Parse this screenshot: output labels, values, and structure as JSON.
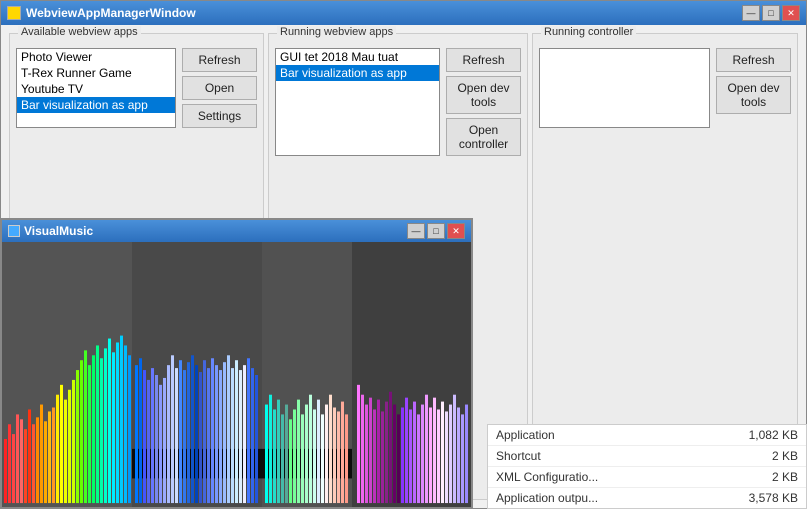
{
  "mainWindow": {
    "title": "WebviewAppManagerWindow",
    "titleButtons": {
      "minimize": "—",
      "maximize": "□",
      "close": "✕"
    }
  },
  "availableApps": {
    "label": "Available webview apps",
    "items": [
      {
        "text": "Photo Viewer",
        "selected": false
      },
      {
        "text": "T-Rex Runner Game",
        "selected": false
      },
      {
        "text": "Youtube TV",
        "selected": false
      },
      {
        "text": "Bar visualization as app",
        "selected": true
      }
    ],
    "buttons": {
      "refresh": "Refresh",
      "open": "Open",
      "settings": "Settings"
    }
  },
  "runningApps": {
    "label": "Running webview apps",
    "items": [
      {
        "text": "GUI tet 2018 Mau tuat",
        "selected": false
      },
      {
        "text": "Bar visualization as app",
        "selected": true
      }
    ],
    "buttons": {
      "refresh": "Refresh",
      "openDevTools": "Open dev\ntools",
      "openController": "Open\ncontroller"
    }
  },
  "runningController": {
    "label": "Running controller",
    "items": [],
    "buttons": {
      "refresh": "Refresh",
      "openDevTools": "Open dev\ntools"
    }
  },
  "subWindow": {
    "title": "VisualMusic",
    "buttons": {
      "minimize": "—",
      "maximize": "□",
      "close": "✕"
    }
  },
  "infoPanel": {
    "rows": [
      {
        "label": "Application",
        "value": "1,082 KB"
      },
      {
        "label": "Shortcut",
        "value": "2 KB"
      },
      {
        "label": "XML Configuratio...",
        "value": "2 KB"
      },
      {
        "label": "Application outpu...",
        "value": "3,578 KB"
      }
    ]
  }
}
